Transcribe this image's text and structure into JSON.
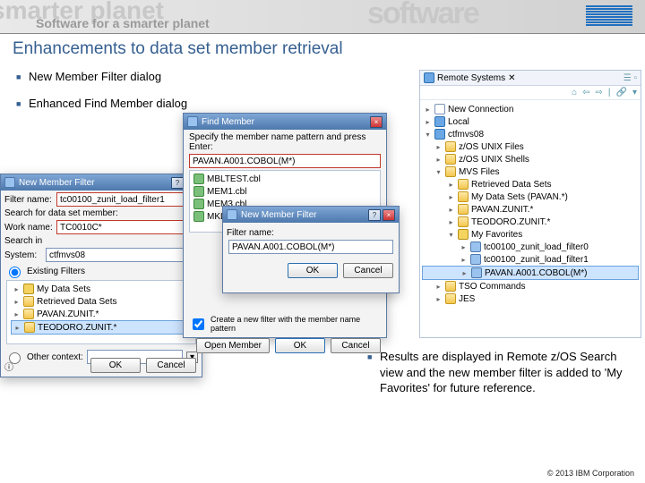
{
  "banner": {
    "bg1": "smarter planet",
    "bg2": "Software for a smarter planet",
    "bg3": "software",
    "logo": "IBM"
  },
  "slide_title": "Enhancements to data set member retrieval",
  "bullets": {
    "b1": "New Member Filter dialog",
    "b2": "Enhanced Find Member dialog",
    "b3": "Results are displayed in Remote z/OS Search view and the new member filter is added to 'My Favorites' for future reference."
  },
  "copyright": "© 2013 IBM Corporation",
  "find_member": {
    "title": "Find Member",
    "desc": "Specify the member name pattern and press Enter:",
    "pattern": "PAVAN.A001.COBOL(M*)",
    "members": [
      "MBLTEST.cbl",
      "MEM1.cbl",
      "MEM3.cbl",
      "MKLNK1.Y.cbl"
    ],
    "checkbox": "Create a new filter with the member name pattern",
    "open_member": "Open Member",
    "ok": "OK",
    "cancel": "Cancel"
  },
  "new_filter": {
    "title": "New Member Filter",
    "label": "Filter name:",
    "value": "PAVAN.A001.COBOL(M*)",
    "ok": "OK",
    "cancel": "Cancel"
  },
  "old_filter": {
    "title": "New Member Filter",
    "filter_name_lbl": "Filter name:",
    "filter_name_val": "tc00100_zunit_load_filter1",
    "search_lbl": "Search for data set member:",
    "work_lbl": "Work name:",
    "work_val": "TC0010C*",
    "search_in_lbl": "Search in",
    "system_lbl": "System:",
    "system_val": "ctfmvs08",
    "existing_lbl": "Existing Filters",
    "tree": [
      "My Data Sets",
      "Retrieved Data Sets",
      "PAVAN.ZUNIT.*",
      "TEODORO.ZUNIT.*"
    ],
    "other_lbl": "Other context:",
    "ok": "OK",
    "cancel": "Cancel"
  },
  "remote": {
    "title": "Remote Systems",
    "toolbar_tip": "⇦ ⇨ ⌂ | 🔗",
    "tree": {
      "new_conn": "New Connection",
      "local": "Local",
      "host": "ctfmvs08",
      "unix": "z/OS UNIX Files",
      "shells": "z/OS UNIX Shells",
      "mvs": "MVS Files",
      "retrieved": "Retrieved Data Sets",
      "mydatasets": "My Data Sets (PAVAN.*)",
      "pavanz": "PAVAN.ZUNIT.*",
      "teodoro": "TEODORO.ZUNIT.*",
      "fav": "My Favorites",
      "f1": "tc00100_zunit_load_filter0",
      "f2": "tc00100_zunit_load_filter1",
      "f3": "PAVAN.A001.COBOL(M*)",
      "tso": "TSO Commands",
      "jes": "JES"
    }
  }
}
